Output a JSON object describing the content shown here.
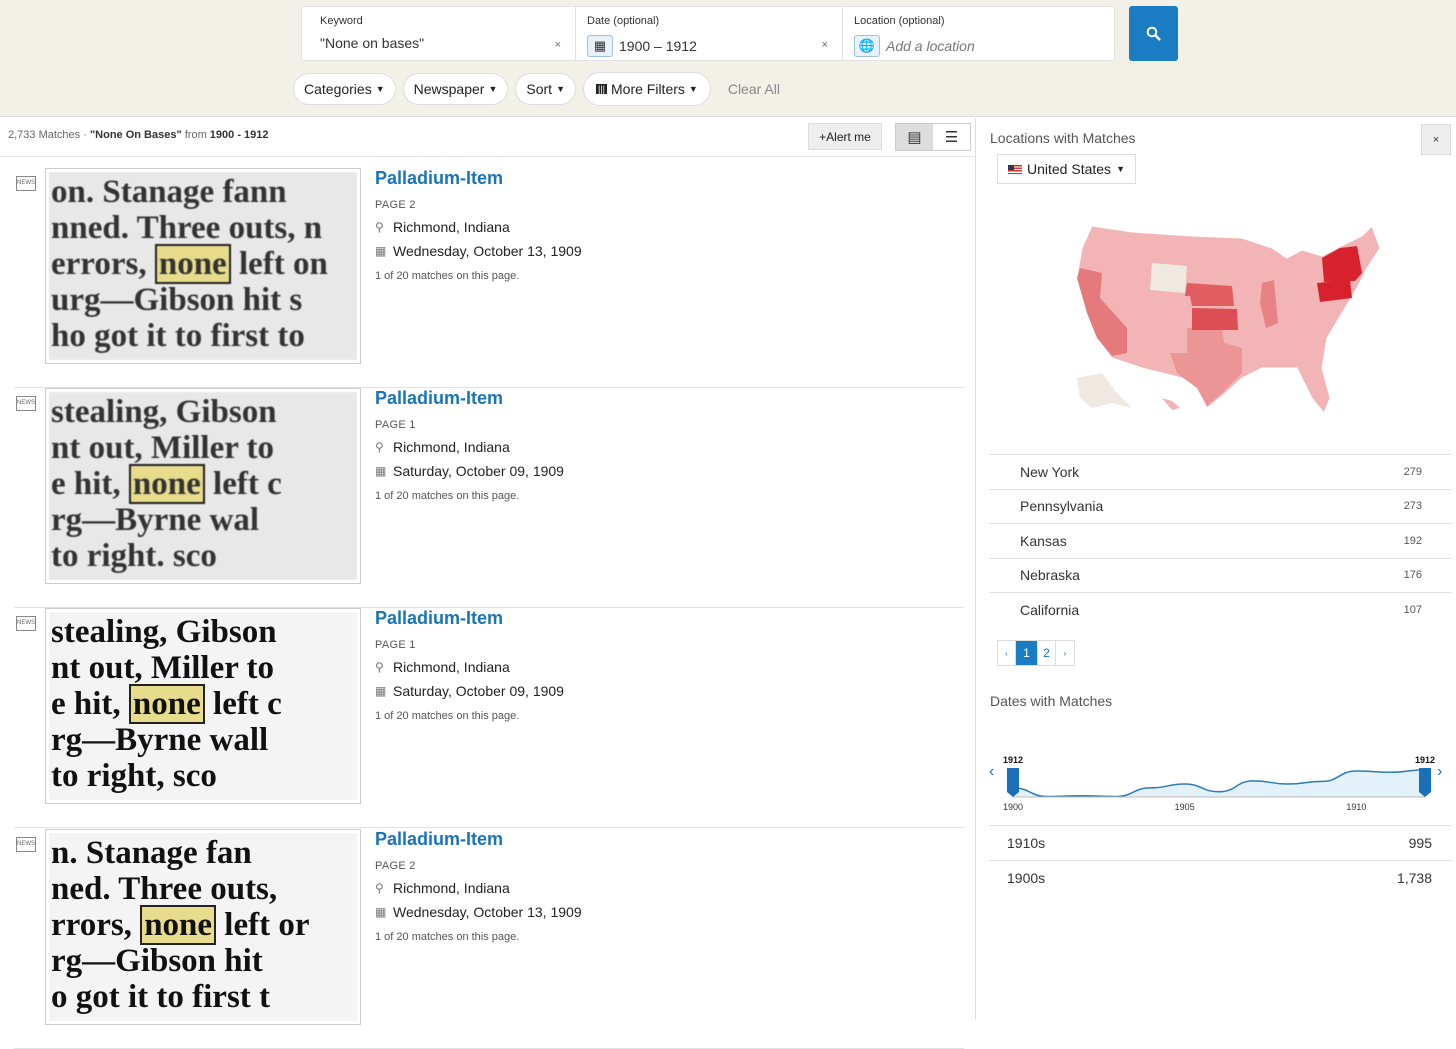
{
  "search": {
    "keyword_label": "Keyword",
    "keyword_value": "\"None on bases\"",
    "date_label": "Date (optional)",
    "date_value": "1900  –  1912",
    "location_label": "Location (optional)",
    "location_placeholder": "Add a location",
    "clear_x": "×"
  },
  "filters": {
    "categories": "Categories",
    "newspaper": "Newspaper",
    "sort": "Sort",
    "more": "More Filters",
    "clear": "Clear All"
  },
  "results_meta": {
    "count": "2,733 Matches · ",
    "query": "\"None On Bases\"",
    "from": " from ",
    "range": "1900 - 1912",
    "alert": "+Alert me"
  },
  "results": [
    {
      "title": "Palladium-Item",
      "page": "PAGE 2",
      "location": "Richmond, Indiana",
      "date": "Wednesday, October 13, 1909",
      "matches": "1 of 20 matches on this page.",
      "clip": [
        "on.   Stanage   fann",
        "nned.  Three outs, n",
        "errors, ",
        "none",
        " left on",
        "urg—Gibson   hit   s",
        "ho got it to first to"
      ]
    },
    {
      "title": "Palladium-Item",
      "page": "PAGE 1",
      "location": "Richmond, Indiana",
      "date": "Saturday, October 09, 1909",
      "matches": "1 of 20 matches on this page.",
      "clip": [
        "stealing,   Gibson",
        "nt out, Miller to",
        "e hit, ",
        "none",
        " left c",
        "rg—Byrne    wal",
        "  to    right.   sco"
      ]
    },
    {
      "title": "Palladium-Item",
      "page": "PAGE 1",
      "location": "Richmond, Indiana",
      "date": "Saturday, October 09, 1909",
      "matches": "1 of 20 matches on this page.",
      "clip": [
        "stealing,   Gibson",
        "nt out, Miller to",
        "e hit, ",
        "none",
        " left c",
        "rg—Byrne    wall",
        "  to   right,   sco"
      ]
    },
    {
      "title": "Palladium-Item",
      "page": "PAGE 2",
      "location": "Richmond, Indiana",
      "date": "Wednesday, October 13, 1909",
      "matches": "1 of 20 matches on this page.",
      "clip": [
        "n.   Stanage   fan",
        "ned.  Three outs,",
        "rrors, ",
        "none",
        " left or",
        "rg—Gibson    hit",
        "o got it to first t"
      ]
    }
  ],
  "sidebar": {
    "locations_title": "Locations with Matches",
    "country": "United States",
    "close": "×",
    "locations": [
      {
        "name": "New York",
        "count": "279"
      },
      {
        "name": "Pennsylvania",
        "count": "273"
      },
      {
        "name": "Kansas",
        "count": "192"
      },
      {
        "name": "Nebraska",
        "count": "176"
      },
      {
        "name": "California",
        "count": "107"
      }
    ],
    "pages": [
      "‹",
      "1",
      "2",
      "›"
    ],
    "dates_title": "Dates with Matches",
    "timeline": {
      "handle_left": "1912",
      "handle_right": "1912",
      "ticks": [
        "1900",
        "1905",
        "1910"
      ],
      "years": [
        1900,
        1901,
        1902,
        1903,
        1904,
        1905,
        1906,
        1907,
        1908,
        1909,
        1910,
        1911,
        1912
      ],
      "relative": [
        0.35,
        0.02,
        0.05,
        0.02,
        0.35,
        0.5,
        0.2,
        0.62,
        0.5,
        0.6,
        1.0,
        0.95,
        1.05
      ]
    },
    "decades": [
      {
        "name": "1910s",
        "count": "995"
      },
      {
        "name": "1900s",
        "count": "1,738"
      }
    ]
  },
  "colors": {
    "accent": "#1a7dc4",
    "map_high": "#d7222e",
    "map_mid": "#e57375",
    "map_low": "#f3b8b8"
  }
}
